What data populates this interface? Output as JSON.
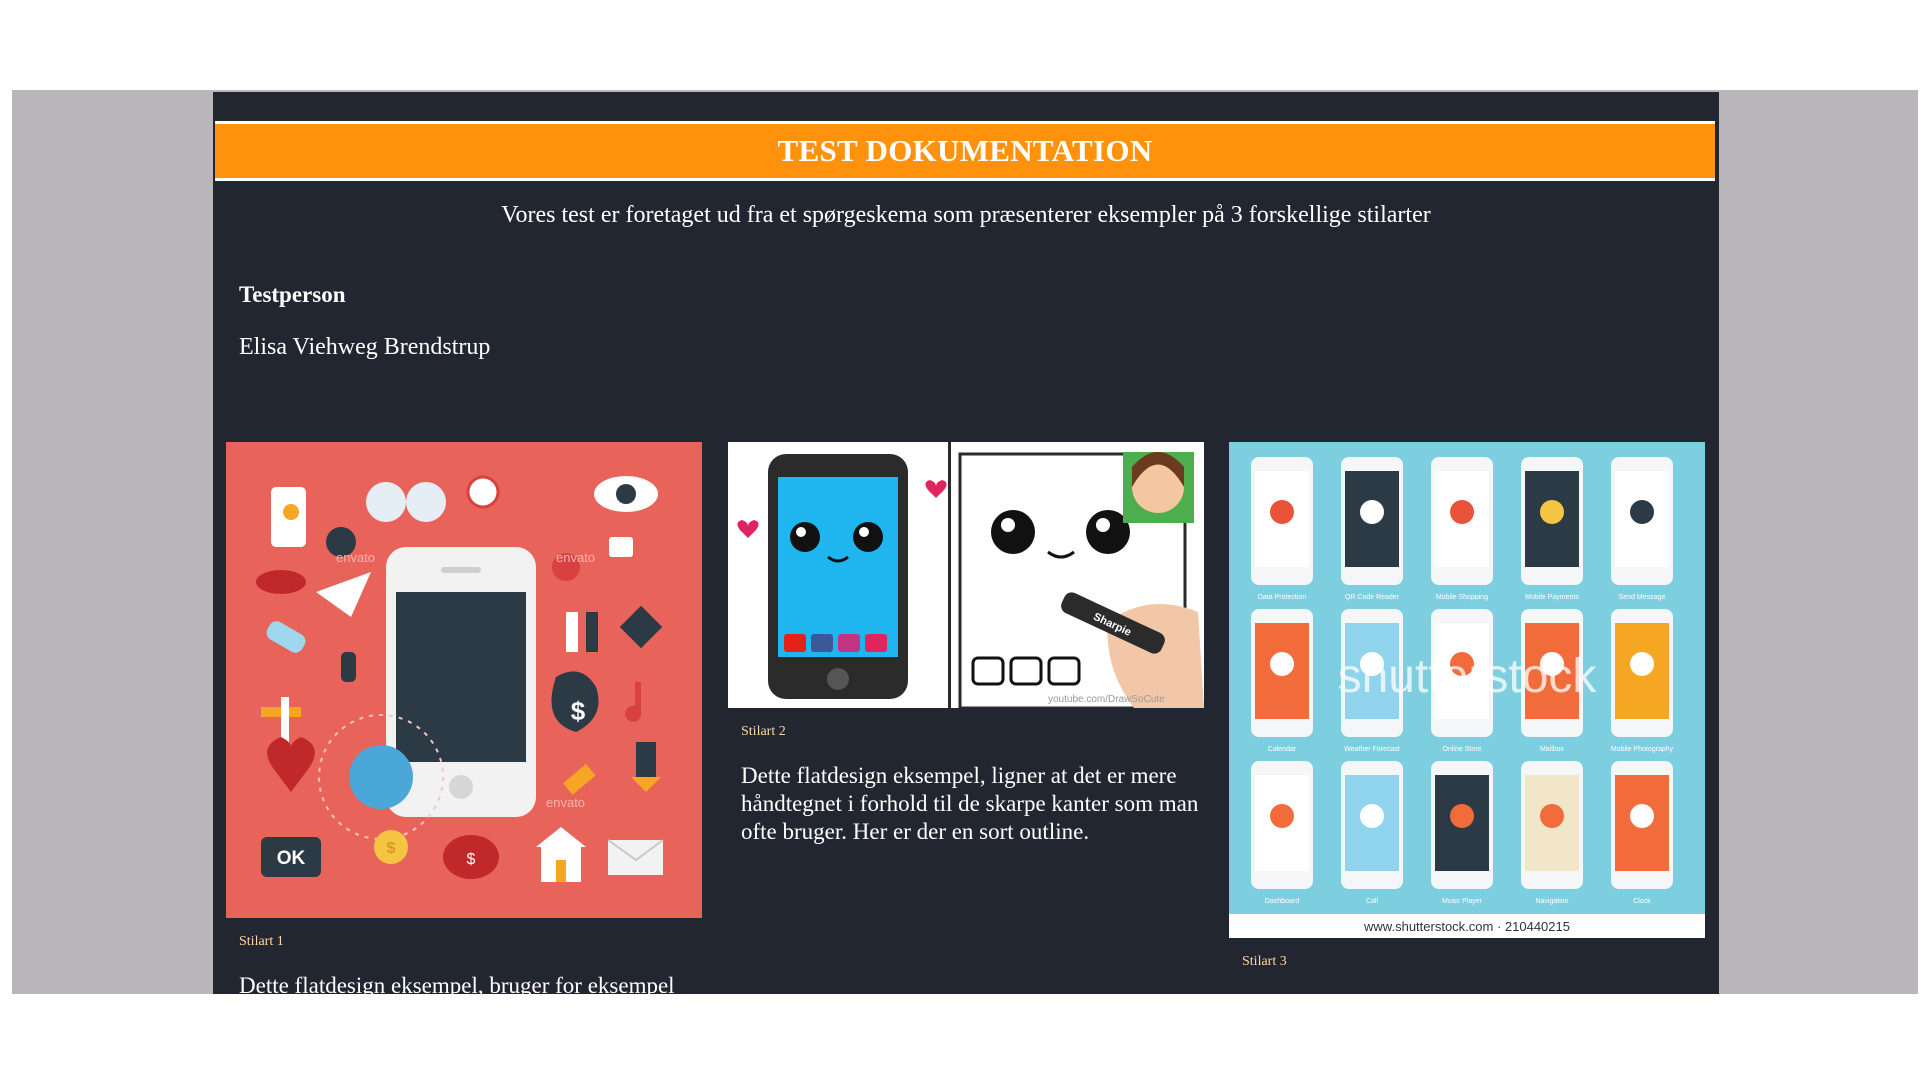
{
  "header": {
    "title": "TEST DOKUMENTATION"
  },
  "intro": "Vores test er foretaget ud fra et spørgeskema som præsenterer eksempler på 3 forskellige stilarter",
  "testperson": {
    "label": "Testperson",
    "name": "Elisa Viehweg Brendstrup"
  },
  "examples": [
    {
      "caption": "Stilart 1",
      "description": "Dette flatdesign eksempel, bruger for eksempel",
      "image_text": [
        "envato",
        "envato",
        "envato",
        "OK",
        "$",
        "$",
        "$"
      ]
    },
    {
      "caption": "Stilart 2",
      "description": "Dette flatdesign eksempel, ligner at det er mere håndtegnet i forhold til de skarpe kanter som man ofte bruger. Her er der en sort outline.",
      "image_text": [
        "youtube.com/DrawSoCute",
        "Sharpie"
      ]
    },
    {
      "caption": "Stilart 3",
      "image_text": {
        "watermark": "shutterstock",
        "footer": "www.shutterstock.com · 210440215",
        "screens": [
          "Data Protection",
          "QR Code Reader",
          "Mobile Shopping",
          "Mobile Payments",
          "Send Message",
          "Calendar",
          "Weather Forecast",
          "Online Store",
          "Mailbox",
          "Mobile Photography",
          "Dashboard",
          "Call",
          "Music Player",
          "Navigation",
          "Clock"
        ]
      }
    }
  ],
  "colors": {
    "banner": "#ff920d",
    "page_bg": "#222631",
    "outer_bg": "#b9b7ba",
    "caption": "#ffd7a0",
    "stilart1_bg": "#e8635a",
    "stilart3_bg": "#7dcfe0"
  }
}
